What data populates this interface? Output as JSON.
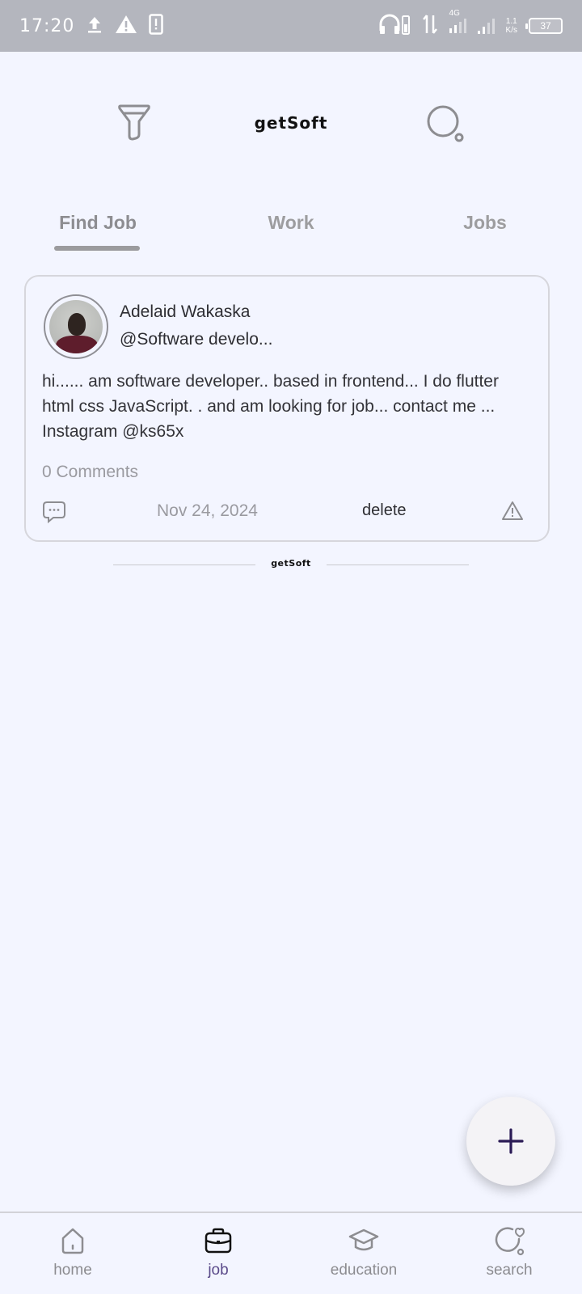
{
  "status_bar": {
    "time": "17:20",
    "network_label": "4G",
    "speed_value": "1.1",
    "speed_unit": "K/s",
    "battery": "37"
  },
  "header": {
    "title": "getSoft"
  },
  "tabs": [
    {
      "label": "Find Job",
      "active": true
    },
    {
      "label": "Work",
      "active": false
    },
    {
      "label": "Jobs",
      "active": false
    }
  ],
  "post": {
    "author_name": "Adelaid Wakaska",
    "author_handle": "@Software develo...",
    "text": "hi...... am software developer.. based in frontend... I do flutter html css JavaScript.   . and am looking for job... contact me ... Instagram @ks65x",
    "comments_label": "0 Comments",
    "date": "Nov 24, 2024",
    "delete_label": "delete"
  },
  "divider": {
    "label": "getSoft"
  },
  "fab": {
    "icon": "plus-icon"
  },
  "bottom_nav": [
    {
      "label": "home",
      "icon": "home-icon",
      "active": false
    },
    {
      "label": "job",
      "icon": "briefcase-icon",
      "active": true
    },
    {
      "label": "education",
      "icon": "graduation-cap-icon",
      "active": false
    },
    {
      "label": "search",
      "icon": "search-heart-icon",
      "active": false
    }
  ],
  "colors": {
    "background": "#f3f5ff",
    "status_bar": "#b4b6be",
    "active_nav": "#5a4a8a",
    "fab_plus": "#2a1a55"
  }
}
